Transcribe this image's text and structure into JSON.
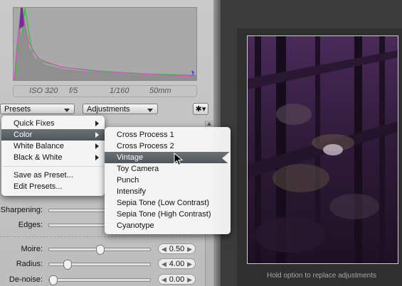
{
  "exif": {
    "iso": "ISO 320",
    "aperture": "f/5",
    "shutter": "1/160",
    "focal": "50mm"
  },
  "toolbar": {
    "presets_label": "Presets",
    "adjustments_label": "Adjustments",
    "gear_icon": "gear-icon"
  },
  "sliders": {
    "sharpening": {
      "label": "Sharpening:"
    },
    "edges": {
      "label": "Edges:"
    },
    "moire": {
      "label": "Moire:",
      "value": "0.50",
      "level": 0.5
    },
    "radius": {
      "label": "Radius:",
      "value": "4.00",
      "level": 0.15
    },
    "denoise": {
      "label": "De-noise:",
      "value": "0.00",
      "level": 0.0
    }
  },
  "presets_menu": {
    "items": [
      {
        "label": "Quick Fixes",
        "submenu": true
      },
      {
        "label": "Color",
        "submenu": true,
        "selected": true
      },
      {
        "label": "White Balance",
        "submenu": true
      },
      {
        "label": "Black & White",
        "submenu": true
      }
    ],
    "actions": [
      {
        "label": "Save as Preset..."
      },
      {
        "label": "Edit Presets..."
      }
    ]
  },
  "color_submenu": {
    "items": [
      "Cross Process 1",
      "Cross Process 2",
      "Vintage",
      "Toy Camera",
      "Punch",
      "Intensify",
      "Sepia Tone (Low Contrast)",
      "Sepia Tone (High Contrast)",
      "Cyanotype"
    ],
    "selected": "Vintage"
  },
  "viewer": {
    "hint": "Hold option to replace adjustments"
  },
  "colors": {
    "menu_highlight": "#5b6268",
    "histogram_green": "#3cc43c",
    "histogram_purple": "#7a2aa0"
  }
}
